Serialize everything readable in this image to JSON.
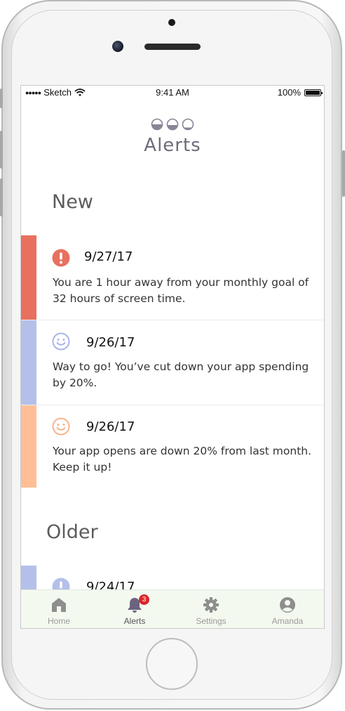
{
  "status_bar": {
    "carrier": "Sketch",
    "time": "9:41 AM",
    "battery": "100%"
  },
  "header": {
    "title": "Alerts"
  },
  "sections": {
    "new_heading": "New",
    "older_heading": "Older"
  },
  "alerts_new": [
    {
      "date": "9/27/17",
      "message": "You are 1 hour away from your monthly goal of 32 hours of screen time.",
      "icon": "exclamation-icon",
      "color": "#e8705f"
    },
    {
      "date": "9/26/17",
      "message": "Way to go! You’ve cut down your app spending by 20%.",
      "icon": "smiley-icon",
      "color": "#b4c0ea"
    },
    {
      "date": "9/26/17",
      "message": "Your app opens are down 20% from last month. Keep it up!",
      "icon": "smiley-icon",
      "color": "#ffbe96"
    }
  ],
  "alerts_older": [
    {
      "date": "9/24/17",
      "icon": "exclamation-icon",
      "color": "#b4c0ea"
    }
  ],
  "tab_bar": {
    "home": "Home",
    "alerts": "Alerts",
    "alerts_badge": "3",
    "settings": "Settings",
    "profile": "Amanda"
  },
  "colors": {
    "title": "#6f6a7a",
    "tab_bar_bg": "#f4f9f0",
    "badge": "#d9262b"
  }
}
